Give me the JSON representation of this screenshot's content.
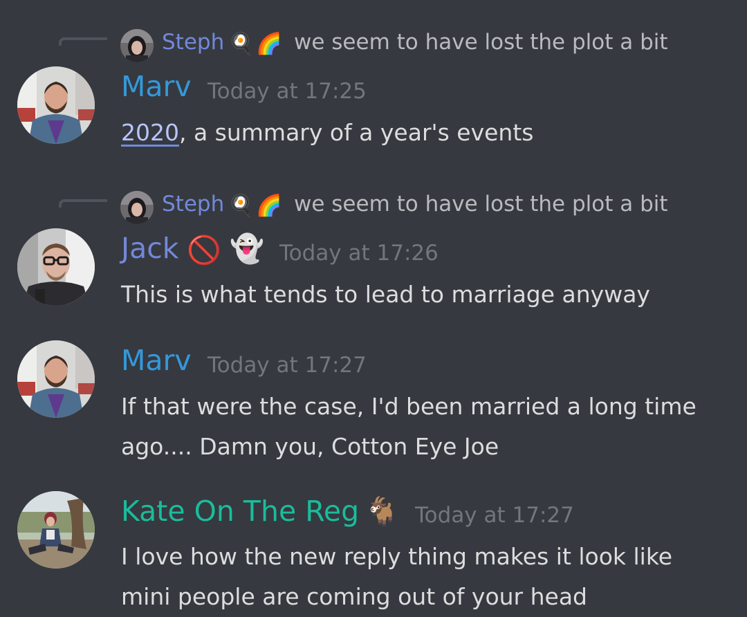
{
  "messages": [
    {
      "reply": {
        "author": "Steph",
        "emojis": [
          "🍳",
          "🌈"
        ],
        "text": "we seem to have lost the plot a bit"
      },
      "author": "Marv",
      "author_color": "#3498db",
      "timestamp": "Today at 17:25",
      "link_text": "2020",
      "text_after_link": ", a summary of a year's events"
    },
    {
      "reply": {
        "author": "Steph",
        "emojis": [
          "🍳",
          "🌈"
        ],
        "text": "we seem to have lost the plot a bit"
      },
      "author": "Jack",
      "author_emojis": [
        "🚫",
        "👻"
      ],
      "author_color": "#7289da",
      "timestamp": "Today at 17:26",
      "lines": [
        "This is what tends to lead to marriage anyway"
      ]
    },
    {
      "author": "Marv",
      "author_color": "#3498db",
      "timestamp": "Today at 17:27",
      "lines": [
        "If that were the case, I'd been married a long time",
        "ago.... Damn you, Cotton Eye Joe"
      ]
    },
    {
      "author": "Kate On The Reg",
      "author_emojis": [
        "🐐"
      ],
      "author_color": "#1abc9c",
      "timestamp": "Today at 17:27",
      "lines": [
        "I love how the new reply thing makes it look like",
        "mini people are coming out of your head"
      ]
    }
  ]
}
